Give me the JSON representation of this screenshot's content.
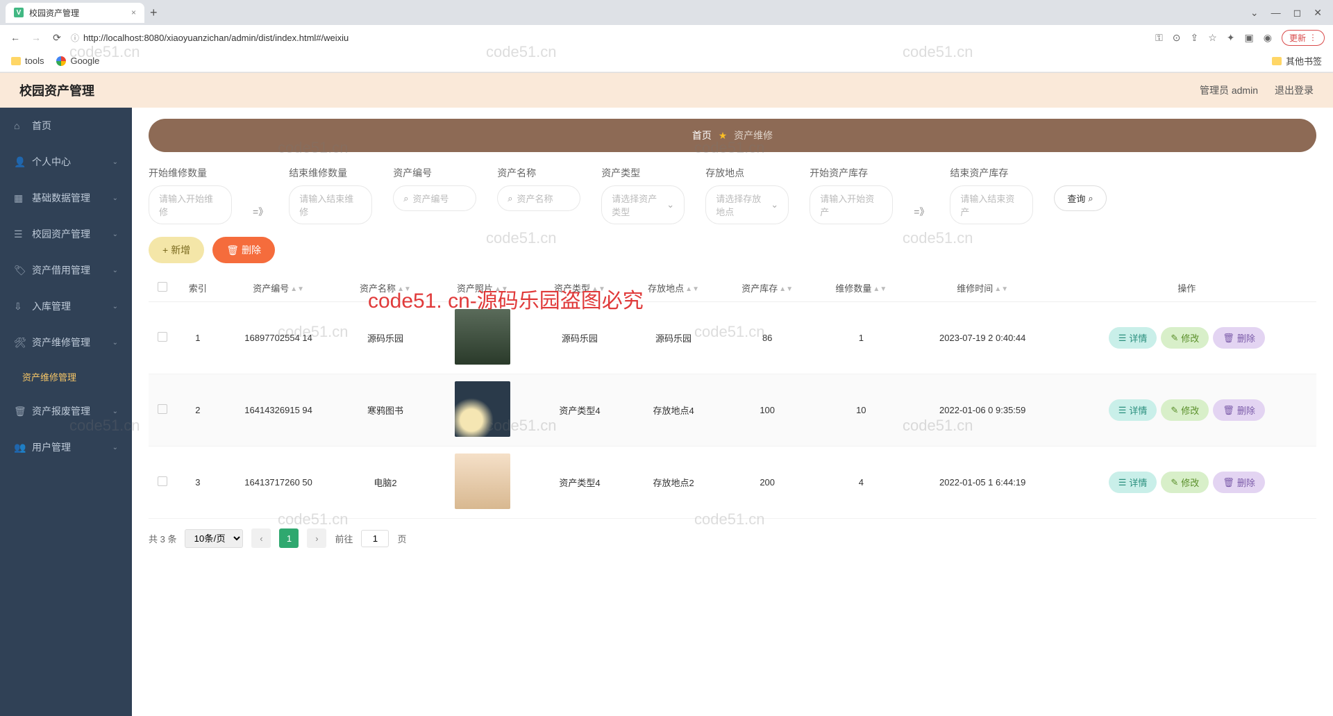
{
  "browser": {
    "tab_title": "校园资产管理",
    "url": "http://localhost:8080/xiaoyuanzichan/admin/dist/index.html#/weixiu",
    "update_label": "更新",
    "bookmarks": {
      "tools": "tools",
      "google": "Google",
      "other": "其他书签"
    }
  },
  "header": {
    "title": "校园资产管理",
    "user_label": "管理员 admin",
    "logout": "退出登录"
  },
  "sidebar": [
    {
      "label": "首页",
      "icon": "home"
    },
    {
      "label": "个人中心",
      "icon": "user",
      "expand": true
    },
    {
      "label": "基础数据管理",
      "icon": "grid",
      "expand": true
    },
    {
      "label": "校园资产管理",
      "icon": "list",
      "expand": true
    },
    {
      "label": "资产借用管理",
      "icon": "tag",
      "expand": true
    },
    {
      "label": "入库管理",
      "icon": "inbox",
      "expand": true
    },
    {
      "label": "资产维修管理",
      "icon": "wrench",
      "expand": true,
      "open": true,
      "children": [
        {
          "label": "资产维修管理",
          "active": true
        }
      ]
    },
    {
      "label": "资产报废管理",
      "icon": "trash",
      "expand": true
    },
    {
      "label": "用户管理",
      "icon": "users",
      "expand": true
    }
  ],
  "breadcrumb": {
    "home": "首页",
    "current": "资产维修"
  },
  "search": {
    "start_qty_label": "开始维修数量",
    "start_qty_ph": "请输入开始维修",
    "end_qty_label": "结束维修数量",
    "end_qty_ph": "请输入结束维修",
    "asset_no_label": "资产编号",
    "asset_no_ph": "资产编号",
    "asset_name_label": "资产名称",
    "asset_name_ph": "资产名称",
    "asset_type_label": "资产类型",
    "asset_type_ph": "请选择资产类型",
    "location_label": "存放地点",
    "location_ph": "请选择存放地点",
    "start_stock_label": "开始资产库存",
    "start_stock_ph": "请输入开始资产",
    "end_stock_label": "结束资产库存",
    "end_stock_ph": "请输入结束资产",
    "query_btn": "查询"
  },
  "actions": {
    "add": "新增",
    "delete": "删除"
  },
  "table": {
    "headers": {
      "index": "索引",
      "asset_no": "资产编号",
      "asset_name": "资产名称",
      "asset_photo": "资产照片",
      "asset_type": "资产类型",
      "location": "存放地点",
      "stock": "资产库存",
      "repair_qty": "维修数量",
      "repair_time": "维修时间",
      "ops": "操作"
    },
    "rows": [
      {
        "idx": "1",
        "no": "16897702554 14",
        "name": "源码乐园",
        "type": "源码乐园",
        "loc": "源码乐园",
        "stock": "86",
        "qty": "1",
        "time": "2023-07-19 2 0:40:44"
      },
      {
        "idx": "2",
        "no": "16414326915 94",
        "name": "寒鸦图书",
        "type": "资产类型4",
        "loc": "存放地点4",
        "stock": "100",
        "qty": "10",
        "time": "2022-01-06 0 9:35:59"
      },
      {
        "idx": "3",
        "no": "16413717260 50",
        "name": "电脑2",
        "type": "资产类型4",
        "loc": "存放地点2",
        "stock": "200",
        "qty": "4",
        "time": "2022-01-05 1 6:44:19"
      }
    ],
    "row_actions": {
      "detail": "详情",
      "edit": "修改",
      "delete": "删除"
    }
  },
  "pagination": {
    "total_label": "共 3 条",
    "page_size": "10条/页",
    "current": "1",
    "goto_prefix": "前往",
    "goto_suffix": "页"
  },
  "watermark": "code51.cn",
  "watermark_red": "code51. cn-源码乐园盗图必究"
}
